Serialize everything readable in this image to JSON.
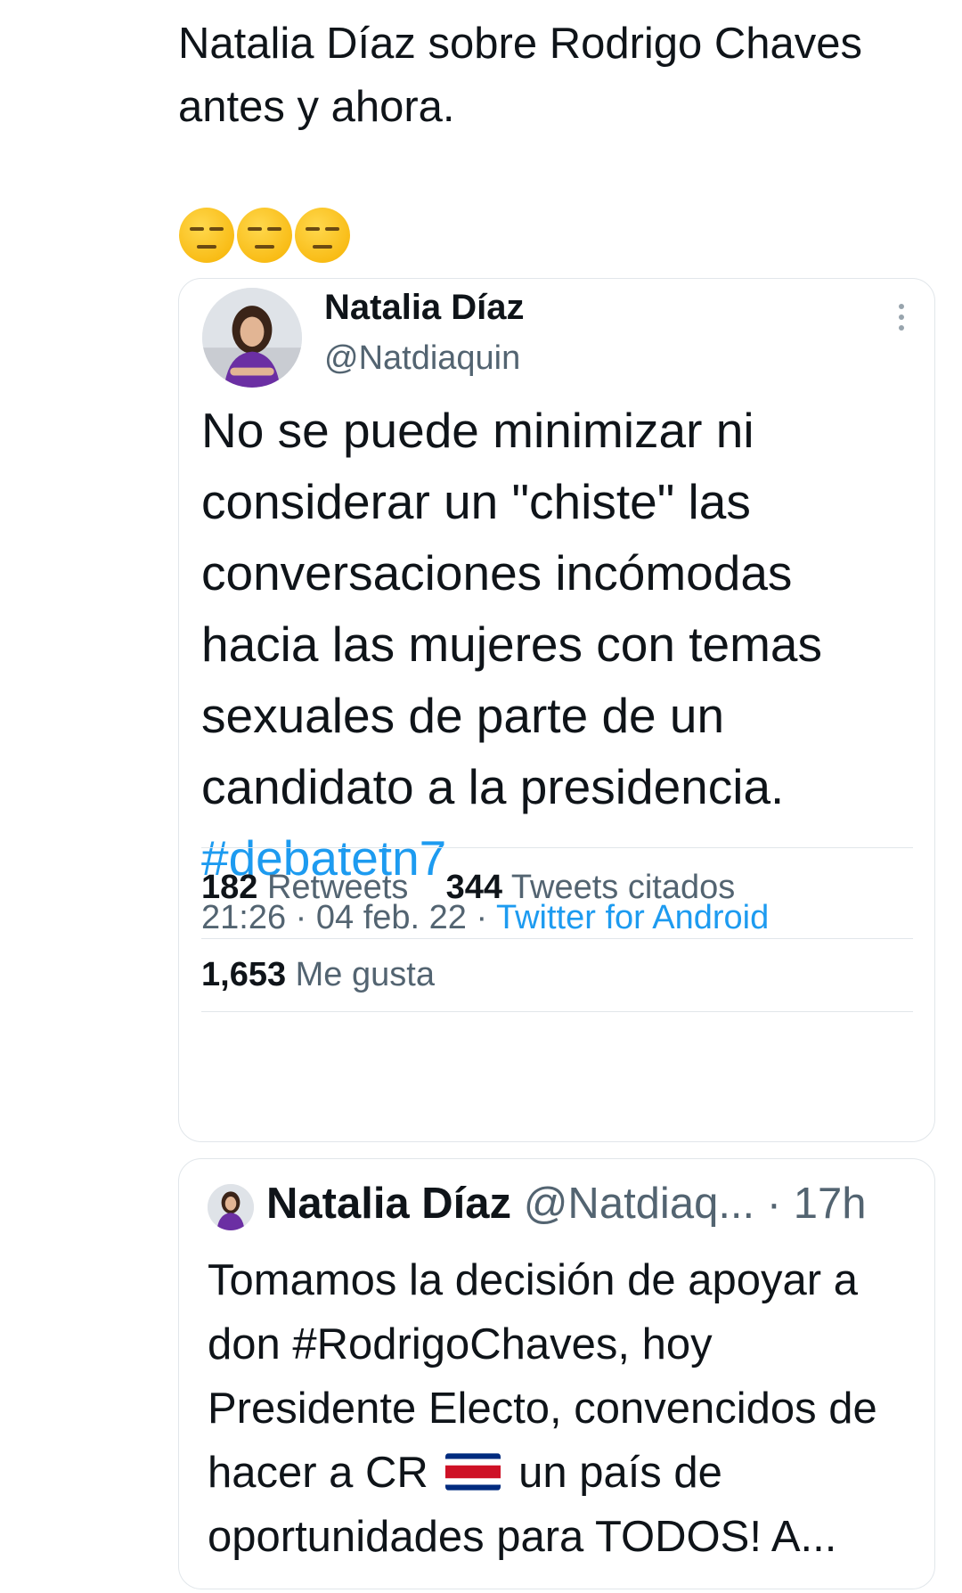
{
  "post": {
    "text": "Natalia Díaz sobre Rodrigo Chaves antes y ahora."
  },
  "emoji": {
    "icon": "expressionless-face",
    "count": 3
  },
  "quoted_tweet": {
    "name": "Natalia Díaz",
    "handle": "@Natdiaquin",
    "text_before_hashtag": "No se puede minimizar ni considerar un \"chiste\" las conversaciones incómodas hacia las mujeres con temas sexuales de parte de un candidato a la presidencia.",
    "hashtag": "#debatetn7",
    "timestamp": "21:26 · 04 feb. 22 ·",
    "source": "Twitter for Android",
    "retweets_count": "182",
    "retweets_label": "Retweets",
    "quotes_count": "344",
    "quotes_label": "Tweets citados",
    "likes_count": "1,653",
    "likes_label": "Me gusta"
  },
  "second_tweet": {
    "name": "Natalia Díaz",
    "handle": "@Natdiaq...",
    "time": "· 17h",
    "text_part1": "Tomamos la decisión de apoyar a don #RodrigoChaves, hoy Presidente Electo, convencidos de hacer a CR",
    "flag_icon": "costa-rica-flag-icon",
    "text_part2": "un país de oportunidades para TODOS! A..."
  },
  "colors": {
    "link": "#1d9bf0",
    "text_primary": "#0f1419",
    "text_secondary": "#536471",
    "border": "#e1e6ea"
  }
}
